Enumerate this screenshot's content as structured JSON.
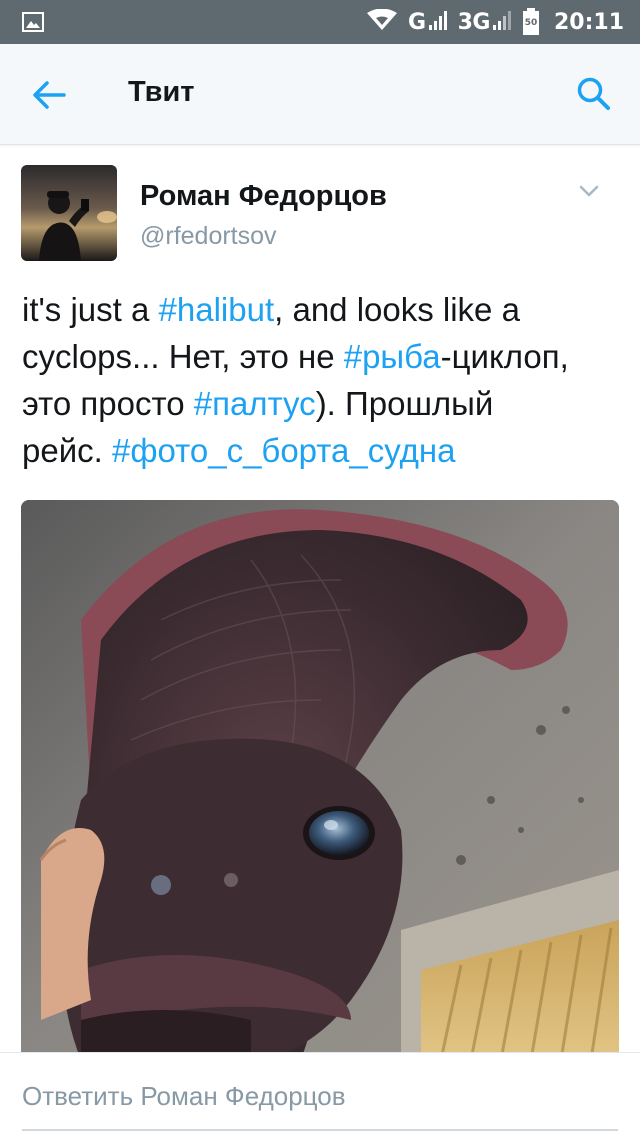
{
  "status_bar": {
    "network_1": "G",
    "network_2": "3G",
    "battery_level": "50",
    "time": "20:11"
  },
  "app_bar": {
    "title": "Твит",
    "back_icon": "arrow-left-icon",
    "search_icon": "search-icon"
  },
  "tweet": {
    "author_name": "Роман Федорцов",
    "author_handle": "@rfedortsov",
    "lines": [
      [
        {
          "text": "it's just a ",
          "tag": false
        },
        {
          "text": "#halibut",
          "tag": true
        },
        {
          "text": ", and looks like a",
          "tag": false
        }
      ],
      [
        {
          "text": "cyclops... Нет, это не ",
          "tag": false
        },
        {
          "text": "#рыба",
          "tag": true
        },
        {
          "text": "-циклоп,",
          "tag": false
        }
      ],
      [
        {
          "text": "это просто ",
          "tag": false
        },
        {
          "text": "#палтус",
          "tag": true
        },
        {
          "text": "). Прошлый",
          "tag": false
        }
      ],
      [
        {
          "text": "рейс. ",
          "tag": false
        },
        {
          "text": "#фото_с_борта_судна",
          "tag": true
        }
      ]
    ]
  },
  "reply": {
    "placeholder": "Ответить Роман Федорцов"
  },
  "colors": {
    "accent": "#1da1f2",
    "text": "#14171a",
    "secondary_text": "#8899a6",
    "status_bar": "#5f6a70"
  }
}
